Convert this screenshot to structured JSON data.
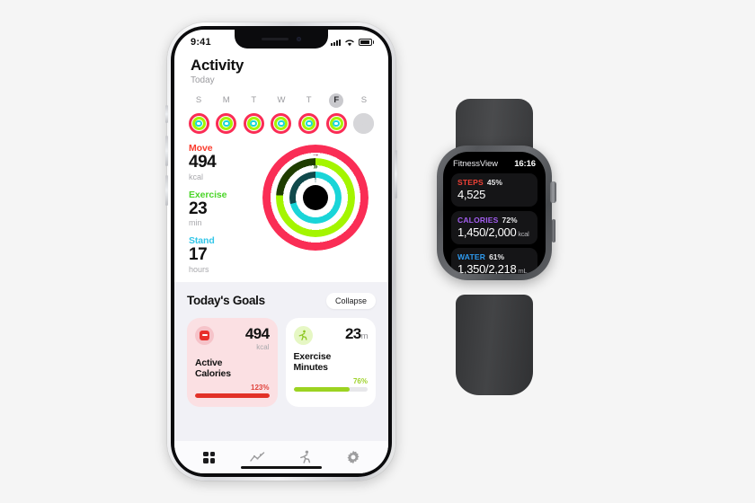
{
  "background_color": "#f5f5f5",
  "phone": {
    "status_bar": {
      "time": "9:41",
      "signal_icon": "signal-bars-icon",
      "wifi_icon": "wifi-icon",
      "battery_icon": "battery-icon"
    },
    "app": {
      "title": "Activity",
      "subtitle": "Today",
      "week": {
        "days": [
          {
            "letter": "S",
            "today": false,
            "dimmed": false
          },
          {
            "letter": "M",
            "today": false,
            "dimmed": false
          },
          {
            "letter": "T",
            "today": false,
            "dimmed": false
          },
          {
            "letter": "W",
            "today": false,
            "dimmed": false
          },
          {
            "letter": "T",
            "today": false,
            "dimmed": false
          },
          {
            "letter": "F",
            "today": true,
            "dimmed": false
          },
          {
            "letter": "S",
            "today": false,
            "dimmed": true
          }
        ]
      },
      "stats": [
        {
          "name": "Move",
          "value": "494",
          "unit": "kcal",
          "color": "#fa3c2d"
        },
        {
          "name": "Exercise",
          "value": "23",
          "unit": "min",
          "color": "#4cd52a"
        },
        {
          "name": "Stand",
          "value": "17",
          "unit": "hours",
          "color": "#33c6e8"
        }
      ],
      "rings": {
        "move": {
          "color": "#fa2d55",
          "track": "#fa2d55",
          "percent": 123,
          "arrow": "→"
        },
        "exercise": {
          "color": "#a4f500",
          "track": "#1f3d00",
          "percent": 76,
          "arrow": "»"
        },
        "stand": {
          "color": "#1ad5d8",
          "track": "#10494b",
          "percent": 71,
          "arrow": "↑"
        }
      },
      "goals": {
        "title": "Today's Goals",
        "collapse_label": "Collapse",
        "cards": [
          {
            "icon": "calories-badge-icon",
            "value": "494",
            "value_suffix": "",
            "unit": "kcal",
            "label": "Active\nCalories",
            "label_line1": "Active",
            "label_line2": "Calories",
            "percent_label": "123%",
            "percent": 100,
            "accent": "#e23127"
          },
          {
            "icon": "running-figure-icon",
            "value": "23",
            "value_suffix": "m",
            "unit": "",
            "label": "Exercise\nMinutes",
            "label_line1": "Exercise",
            "label_line2": "Minutes",
            "percent_label": "76%",
            "percent": 76,
            "accent": "#9cd321"
          }
        ]
      },
      "tabs": [
        {
          "icon": "dashboard-grid-icon",
          "active": true
        },
        {
          "icon": "trends-chart-icon",
          "active": false
        },
        {
          "icon": "workout-runner-icon",
          "active": false
        },
        {
          "icon": "settings-gear-icon",
          "active": false
        }
      ]
    }
  },
  "watch": {
    "header": {
      "app_name": "FitnessView",
      "time": "16:16"
    },
    "metrics": [
      {
        "label": "STEPS",
        "percent": "45%",
        "value": "4,525",
        "unit": "",
        "color": "#ef4136"
      },
      {
        "label": "CALORIES",
        "percent": "72%",
        "value": "1,450/2,000",
        "unit": "kcal",
        "color": "#a35ef0"
      },
      {
        "label": "WATER",
        "percent": "61%",
        "value": "1,350/2,218",
        "unit": "mL",
        "color": "#2e9bf0"
      }
    ],
    "hardware": {
      "crown": "digital-crown",
      "side_button": "side-button",
      "band_color": "#3d3e40"
    }
  }
}
